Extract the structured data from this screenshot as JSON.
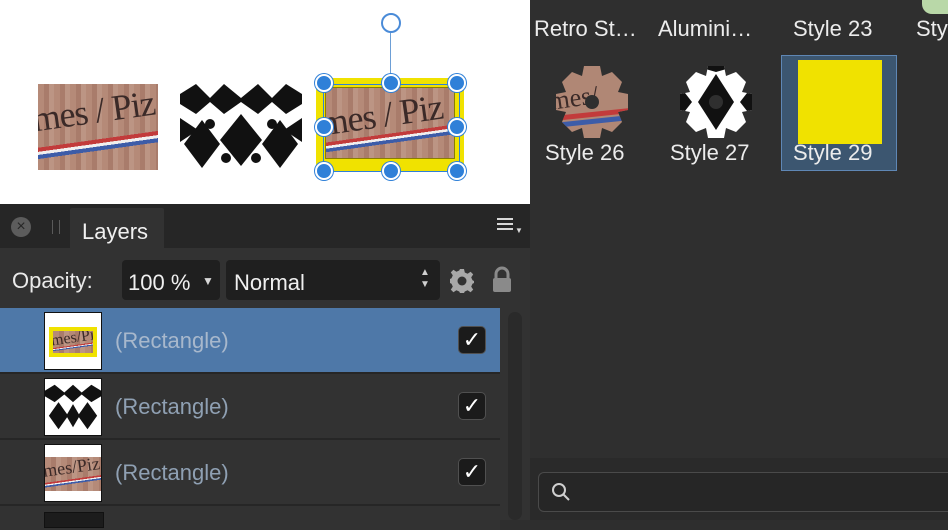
{
  "canvas": {
    "objects": [
      {
        "kind": "wood-text-photo",
        "text": "mes / Piz"
      },
      {
        "kind": "black-white-pattern"
      },
      {
        "kind": "wood-text-photo-selected",
        "text": "mes / Piz",
        "fill_color": "#f0e200"
      }
    ],
    "selection_color": "#2f80d8"
  },
  "styles_panel": {
    "top_labels": [
      "Retro St…",
      "Alumini…",
      "Style 23",
      "Sty"
    ],
    "tiles": [
      {
        "label": "Style 26",
        "preview": "wood-gear"
      },
      {
        "label": "Style 27",
        "preview": "pattern-gear"
      },
      {
        "label": "Style 29",
        "preview": "yellow-square",
        "selected": true
      }
    ],
    "accent_color": "#f0e200"
  },
  "search": {
    "icon": "search-icon",
    "placeholder": ""
  },
  "layers_panel": {
    "tab_label": "Layers",
    "opacity_label": "Opacity:",
    "opacity_value": "100 %",
    "blend_mode": "Normal",
    "rows": [
      {
        "name": "(Rectangle)",
        "thumb": "wood-yellow",
        "visible": true,
        "selected": true,
        "check": "✓"
      },
      {
        "name": "(Rectangle)",
        "thumb": "pattern",
        "visible": true,
        "selected": false,
        "check": "✓"
      },
      {
        "name": "(Rectangle)",
        "thumb": "wood",
        "visible": true,
        "selected": false,
        "check": "✓"
      }
    ],
    "selected_row_color": "#4e78a8"
  }
}
